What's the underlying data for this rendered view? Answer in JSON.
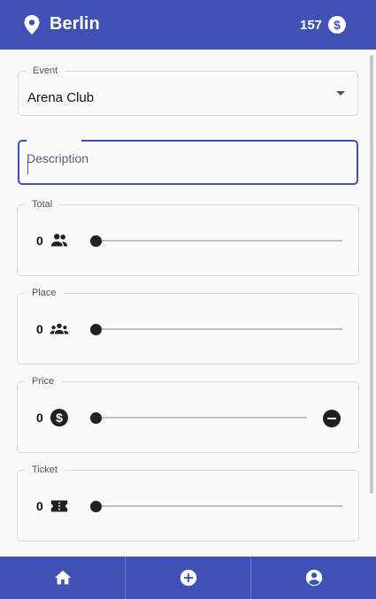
{
  "app_bar": {
    "city": "Berlin",
    "credits": "157",
    "background": "#3f51b5"
  },
  "event": {
    "label": "Event",
    "value": "Arena Club"
  },
  "description": {
    "placeholder": "Description",
    "value": ""
  },
  "sliders": {
    "total": {
      "label": "Total",
      "value": "0",
      "icon": "group-icon",
      "level": 0
    },
    "place": {
      "label": "Place",
      "value": "0",
      "icon": "groups-icon",
      "level": 0
    },
    "price": {
      "label": "Price",
      "value": "0",
      "icon": "dollar-icon",
      "level": 0
    },
    "ticket": {
      "label": "Ticket",
      "value": "0",
      "icon": "ticket-icon",
      "level": 0
    }
  },
  "bottom_nav": {
    "items": [
      {
        "name": "home",
        "icon": "home-icon"
      },
      {
        "name": "add",
        "icon": "add-circle-icon"
      },
      {
        "name": "account",
        "icon": "account-circle-icon"
      }
    ]
  }
}
